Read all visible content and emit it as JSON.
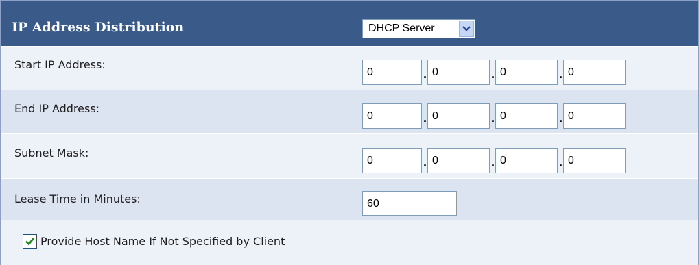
{
  "header": {
    "label": "IP Address Distribution",
    "select_value": "DHCP Server"
  },
  "rows": {
    "start_ip": {
      "label": "Start IP Address:",
      "octets": [
        "0",
        "0",
        "0",
        "0"
      ]
    },
    "end_ip": {
      "label": "End IP Address:",
      "octets": [
        "0",
        "0",
        "0",
        "0"
      ]
    },
    "subnet": {
      "label": "Subnet Mask:",
      "octets": [
        "0",
        "0",
        "0",
        "0"
      ]
    },
    "lease": {
      "label": "Lease Time in Minutes:",
      "value": "60"
    },
    "hostname": {
      "label": "Provide Host Name If Not Specified by Client",
      "checked": true
    }
  },
  "separator": ".",
  "icons": {
    "select_arrow": "chevron-down-icon",
    "checkbox_check": "checkmark-icon"
  },
  "colors": {
    "header_bg": "#3a5a8a",
    "row_light": "#edf1f8",
    "row_dark": "#dce3f1",
    "input_border": "#7f9db9"
  }
}
